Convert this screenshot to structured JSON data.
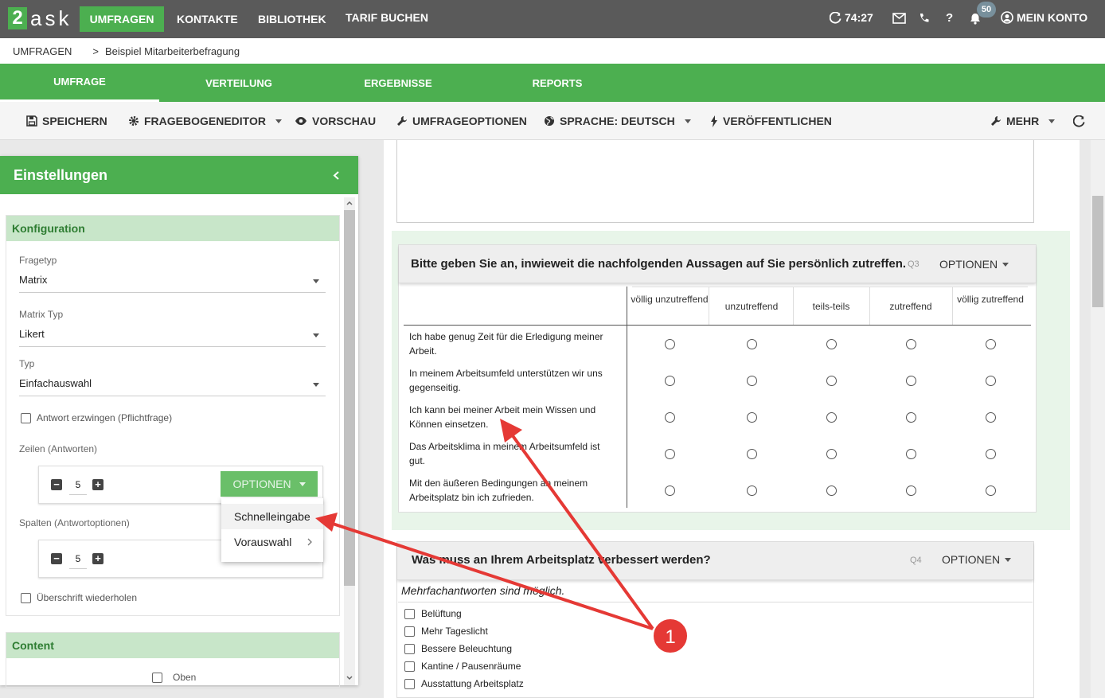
{
  "app": {
    "logo_digit": "2",
    "logo_text": "ask"
  },
  "topnav": {
    "items": [
      "UMFRAGEN",
      "KONTAKTE",
      "BIBLIOTHEK",
      "TARIF BUCHEN"
    ],
    "timer": "74:27",
    "badge_count": "50",
    "help": "?",
    "account": "MEIN KONTO"
  },
  "breadcrumb": {
    "root": "UMFRAGEN",
    "sep": ">",
    "current": "Beispiel Mitarbeiterbefragung"
  },
  "tabs": [
    "UMFRAGE",
    "VERTEILUNG",
    "ERGEBNISSE",
    "REPORTS"
  ],
  "toolbar": {
    "save": "SPEICHERN",
    "editor": "FRAGEBOGENEDITOR",
    "preview": "VORSCHAU",
    "options": "UMFRAGEOPTIONEN",
    "language": "SPRACHE: DEUTSCH",
    "publish": "VERÖFFENTLICHEN",
    "more": "MEHR"
  },
  "settings": {
    "title": "Einstellungen",
    "config_title": "Konfiguration",
    "fragetyp_label": "Fragetyp",
    "fragetyp_value": "Matrix",
    "matrixtyp_label": "Matrix Typ",
    "matrixtyp_value": "Likert",
    "typ_label": "Typ",
    "typ_value": "Einfachauswahl",
    "required_label": "Antwort erzwingen (Pflichtfrage)",
    "rows_label": "Zeilen (Antworten)",
    "rows_value": "5",
    "options_button": "OPTIONEN",
    "menu_items": [
      "Schnelleingabe",
      "Vorauswahl"
    ],
    "cols_label": "Spalten (Antwortoptionen)",
    "cols_value": "5",
    "repeat_header_label": "Überschrift wiederholen",
    "content_title": "Content",
    "top_label": "Oben"
  },
  "q3": {
    "title": "Bitte geben Sie an, inwieweit die nachfolgenden Aussagen auf Sie persönlich zutreffen.",
    "number": "Q3",
    "options": "OPTIONEN",
    "columns": [
      "völlig unzutreffend",
      "unzutreffend",
      "teils-teils",
      "zutreffend",
      "völlig zutreffend"
    ],
    "rows": [
      "Ich habe genug Zeit für die Erledigung meiner Arbeit.",
      "In meinem Arbeitsumfeld unterstützen wir uns gegenseitig.",
      "Ich kann bei meiner Arbeit mein Wissen und Können einsetzen.",
      "Das Arbeitsklima in meinem Arbeitsumfeld ist gut.",
      "Mit den äußeren Bedingungen an meinem Arbeitsplatz bin ich zufrieden."
    ]
  },
  "q4": {
    "title": "Was muss an Ihrem Arbeitsplatz verbessert werden?",
    "number": "Q4",
    "options": "OPTIONEN",
    "hint": "Mehrfachantworten sind möglich.",
    "choices": [
      "Belüftung",
      "Mehr Tageslicht",
      "Bessere Beleuchtung",
      "Kantine / Pausenräume",
      "Ausstattung Arbeitsplatz"
    ]
  },
  "annotation": {
    "label": "1",
    "color": "#e53935"
  }
}
